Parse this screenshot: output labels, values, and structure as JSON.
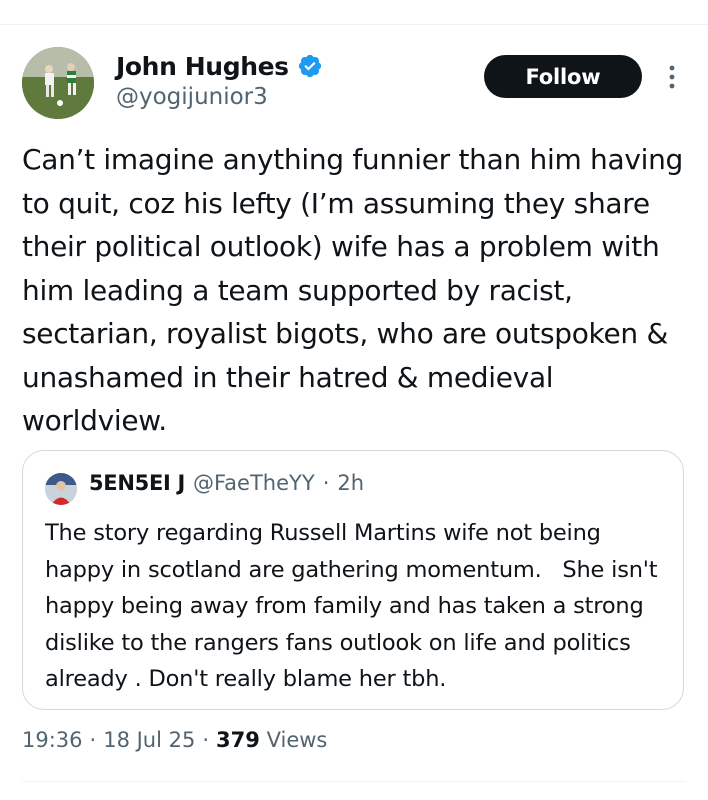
{
  "tweet": {
    "author": {
      "display_name": "John Hughes",
      "handle": "@yogijunior3",
      "verified": true,
      "verified_color": "#1d9bf0"
    },
    "follow_label": "Follow",
    "text": "Can’t imagine anything funnier than him having to quit, coz his lefty (I’m assuming they share their political outlook) wife has a problem with him leading a team supported by racist, sectarian, royalist bigots, who are outspoken & unashamed in their hatred & medieval worldview.",
    "quoted": {
      "display_name": "5EN5EI J",
      "handle": "@FaeTheYY",
      "separator": "·",
      "time": "2h",
      "text": "The story regarding Russell Martins wife not being happy in scotland are gathering momentum.   She isn't happy being away from family and has taken a strong dislike to the rangers fans outlook on life and politics already . Don't really blame her tbh."
    },
    "meta": {
      "time": "19:36",
      "sep1": "·",
      "date": "18 Jul 25",
      "sep2": "·",
      "views_count": "379",
      "views_label": "Views"
    }
  },
  "colors": {
    "text_primary": "#0f1419",
    "text_secondary": "#536471",
    "border": "#cfd9de",
    "follow_bg": "#0f1419"
  }
}
